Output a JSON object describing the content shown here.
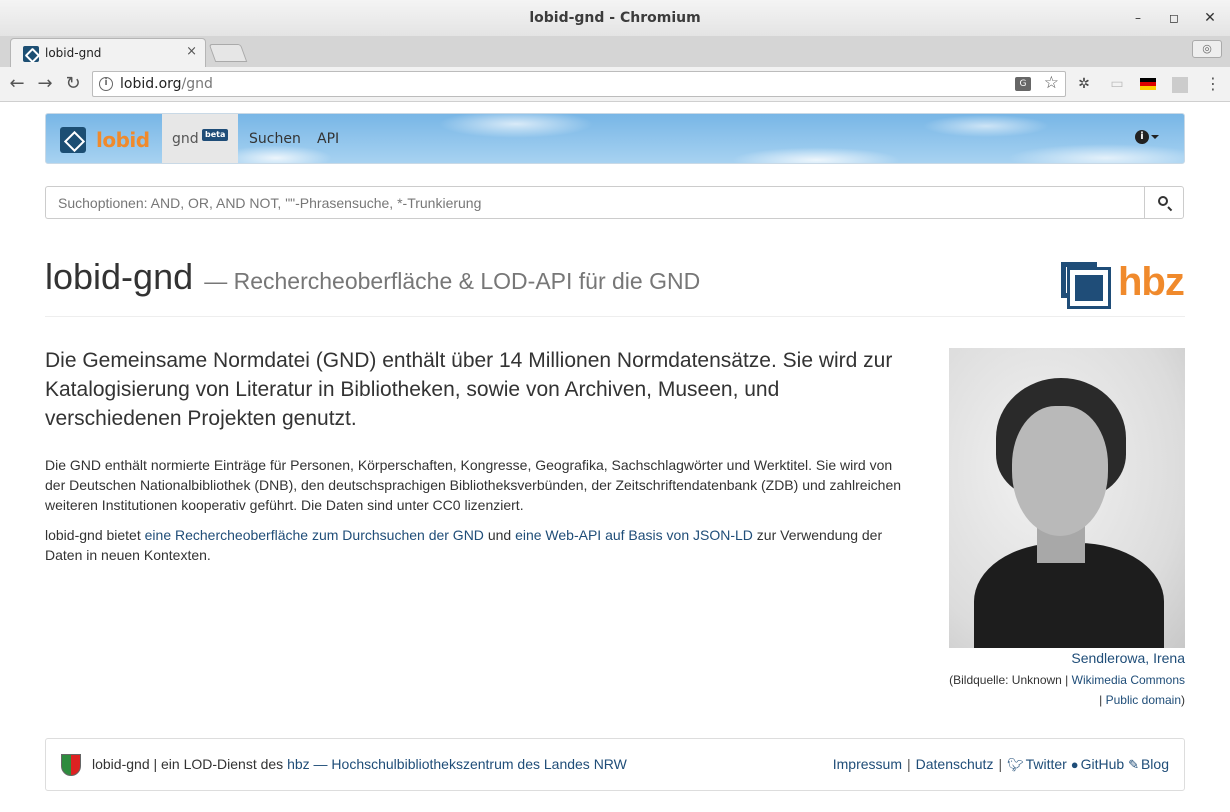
{
  "window": {
    "title": "lobid-gnd - Chromium",
    "minimize": "–",
    "maximize": "◻",
    "close": "✕"
  },
  "tabs": [
    {
      "label": "lobid-gnd",
      "close": "×"
    }
  ],
  "browser": {
    "url_host": "lobid.org",
    "url_path": "/gnd",
    "back": "←",
    "forward": "→",
    "reload": "↻",
    "star": "☆",
    "menu": "⋮",
    "profile": "◎"
  },
  "navbar": {
    "brand": "lobid",
    "gnd_label": "gnd",
    "beta_badge": "beta",
    "links": [
      "Suchen",
      "API"
    ],
    "info": "i"
  },
  "search": {
    "placeholder": "Suchoptionen: AND, OR, AND NOT, \"\"-Phrasensuche, *-Trunkierung"
  },
  "header": {
    "title": "lobid-gnd",
    "subtitle": "— Rechercheoberfläche & LOD-API für die GND",
    "logo_text": "hbz"
  },
  "main": {
    "lead": "Die Gemeinsame Normdatei (GND) enthält über 14 Millionen Normdatensätze. Sie wird zur Katalogisierung von Literatur in Bibliotheken, sowie von Archiven, Museen, und verschiedenen Projekten genutzt.",
    "para1": "Die GND enthält normierte Einträge für Personen, Körperschaften, Kongresse, Geografika, Sachschlagwörter und Werktitel. Sie wird von der Deutschen Nationalbibliothek (DNB), den deutschsprachigen Bibliotheksverbünden, der Zeitschriftendatenbank (ZDB) und zahlreichen weiteren Institutionen kooperativ geführt. Die Daten sind unter CC0 lizenziert.",
    "para2_prefix": "lobid-gnd bietet",
    "para2_link1": "eine Rechercheoberfläche zum Durchsuchen der GND",
    "para2_mid": "und",
    "para2_link2": "eine Web-API auf Basis von JSON-LD",
    "para2_suffix": "zur Verwendung der Daten in neuen Kontexten."
  },
  "image_caption": {
    "name": "Sendlerowa, Irena",
    "source_prefix": "(Bildquelle: Unknown |",
    "source_link1": "Wikimedia Commons",
    "separator": "|",
    "source_link2": "Public domain",
    "source_suffix": ")"
  },
  "footer": {
    "text_prefix": "lobid-gnd | ein LOD-Dienst des",
    "hbz_link": "hbz — Hochschulbibliothekszentrum des Landes NRW",
    "links": [
      "Impressum",
      "Datenschutz",
      "Twitter",
      "GitHub",
      "Blog"
    ],
    "separator": "|"
  }
}
